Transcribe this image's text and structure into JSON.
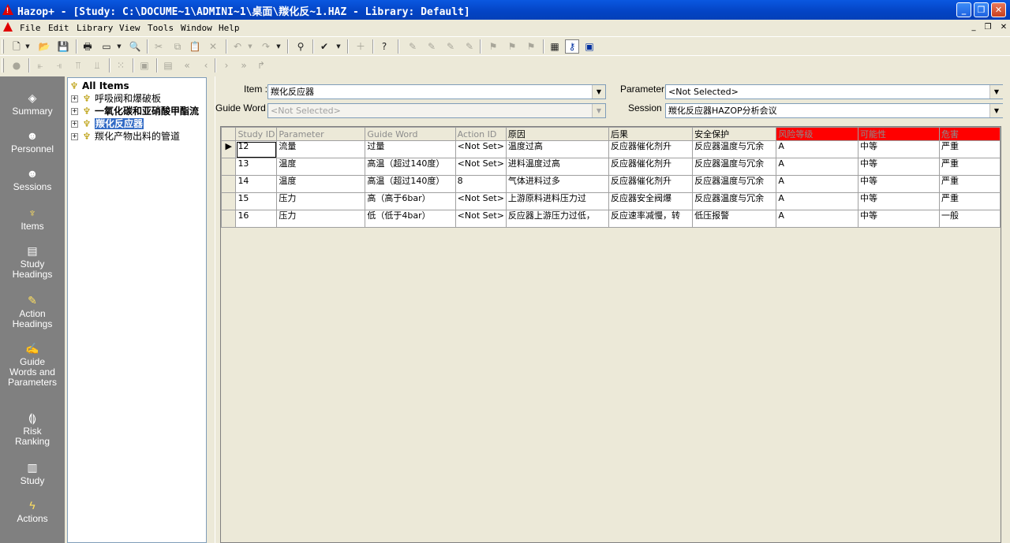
{
  "window": {
    "title": "Hazop+ - [Study: C:\\DOCUME~1\\ADMINI~1\\桌面\\羰化反~1.HAZ - Library: Default]",
    "app_icon_glyph": "!",
    "controls": {
      "minimize": "_",
      "restore": "❐",
      "close": "✕"
    }
  },
  "menubar": {
    "items": [
      "File",
      "Edit",
      "Library",
      "View",
      "Tools",
      "Window",
      "Help"
    ],
    "mdi_controls": {
      "minimize": "_",
      "restore": "❐",
      "close": "✕"
    }
  },
  "toolbar1": {
    "icons": [
      "new-icon",
      "open-icon",
      "save-icon",
      "print-icon",
      "view-icon",
      "print-preview-icon",
      "cut-icon",
      "copy-icon",
      "paste-icon",
      "delete-icon",
      "undo-icon",
      "redo-icon",
      "find-icon",
      "spellcheck-icon",
      "add-icon",
      "help-icon",
      "worksheet-icons",
      "grid-icon",
      "key-icon",
      "calendar-icon"
    ]
  },
  "toolbar2": {
    "icons": [
      "record-icon",
      "align-icons",
      "first-icon",
      "prev-icon",
      "next-icon",
      "last-icon",
      "goto-icon"
    ]
  },
  "sidebar": {
    "items": [
      {
        "label": "Summary",
        "icon": "summary-icon"
      },
      {
        "label": "Personnel",
        "icon": "personnel-icon"
      },
      {
        "label": "Sessions",
        "icon": "sessions-icon"
      },
      {
        "label": "Items",
        "icon": "items-icon"
      },
      {
        "label": "Study\nHeadings",
        "icon": "study-headings-icon"
      },
      {
        "label": "Action\nHeadings",
        "icon": "action-headings-icon"
      },
      {
        "label": "Guide\nWords and\nParameters",
        "icon": "guide-words-icon"
      },
      {
        "label": "Risk\nRanking",
        "icon": "risk-ranking-icon"
      },
      {
        "label": "Study",
        "icon": "study-icon"
      },
      {
        "label": "Actions",
        "icon": "actions-icon"
      }
    ]
  },
  "tree": {
    "root": "All Items",
    "nodes": [
      {
        "label": "呼吸阀和爆破板",
        "bold": false
      },
      {
        "label": "一氧化碳和亚硝酸甲酯流",
        "bold": true
      },
      {
        "label": "羰化反应器",
        "bold": true,
        "selected": true
      },
      {
        "label": "羰化产物出料的管道",
        "bold": false
      }
    ]
  },
  "filters": {
    "item_label": "Item :",
    "item_value": "羰化反应器",
    "guideword_label": "Guide Word :",
    "guideword_value": "<Not Selected>",
    "parameter_label": "Parameter :",
    "parameter_value": "<Not Selected>",
    "session_label": "Session :",
    "session_value": "羰化反应器HAZOP分析会议"
  },
  "grid": {
    "columns": [
      {
        "label": "Study ID",
        "style": "normal"
      },
      {
        "label": "Parameter",
        "style": "normal"
      },
      {
        "label": "Guide Word",
        "style": "normal"
      },
      {
        "label": "Action ID",
        "style": "normal"
      },
      {
        "label": "原因",
        "style": "dark"
      },
      {
        "label": "后果",
        "style": "dark"
      },
      {
        "label": "安全保护",
        "style": "dark"
      },
      {
        "label": "风险等级",
        "style": "red"
      },
      {
        "label": "可能性",
        "style": "red"
      },
      {
        "label": "危害",
        "style": "red"
      }
    ],
    "rows": [
      [
        "12",
        "流量",
        "过量",
        "<Not Set>",
        "温度过高",
        "反应器催化剂升",
        "反应器温度与冗余",
        "A",
        "中等",
        "严重"
      ],
      [
        "13",
        "温度",
        "高温（超过140度）",
        "<Not Set>",
        "进料温度过高",
        "反应器催化剂升",
        "反应器温度与冗余",
        "A",
        "中等",
        "严重"
      ],
      [
        "14",
        "温度",
        "高温（超过140度）",
        "8",
        "气体进料过多",
        "反应器催化剂升",
        "反应器温度与冗余",
        "A",
        "中等",
        "严重"
      ],
      [
        "15",
        "压力",
        "高（高于6bar）",
        "<Not Set>",
        "上游原料进料压力过",
        "反应器安全阀爆",
        "反应器温度与冗余",
        "A",
        "中等",
        "严重"
      ],
      [
        "16",
        "压力",
        "低（低于4bar）",
        "<Not Set>",
        "反应器上游压力过低，",
        "反应速率减慢，转",
        "低压报警",
        "A",
        "中等",
        "一般"
      ]
    ],
    "current_row_marker": "▶"
  }
}
